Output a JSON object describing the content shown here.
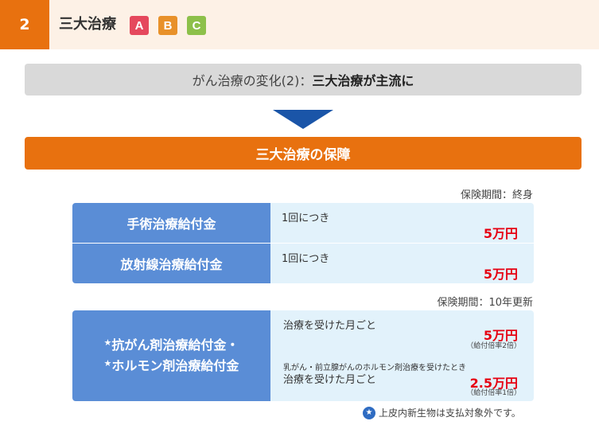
{
  "header": {
    "number": "2",
    "title": "三大治療",
    "badges": [
      {
        "label": "A",
        "color": "#e5485d"
      },
      {
        "label": "B",
        "color": "#e8912a"
      },
      {
        "label": "C",
        "color": "#8dc04a"
      }
    ]
  },
  "change_banner": {
    "prefix": "がん治療の変化(2)：",
    "emphasis": "三大治療が主流に"
  },
  "coverage_title": "三大治療の保障",
  "table1": {
    "period": "保険期間：終身",
    "rows": [
      {
        "label": "手術治療給付金",
        "condition": "1回につき",
        "amount": "5万円"
      },
      {
        "label": "放射線治療給付金",
        "condition": "1回につき",
        "amount": "5万円"
      }
    ]
  },
  "table2": {
    "period": "保険期間：10年更新",
    "star": "★",
    "label_line1": "抗がん剤治療給付金・",
    "label_line2": "ホルモン剤治療給付金",
    "condition1": "治療を受けた月ごと",
    "amount1": "5万円",
    "note1": "（給付倍率2倍）",
    "condition2_line1": "乳がん・前立腺がんのホルモン剤治療を受けたとき",
    "condition2_line2": "治療を受けた月ごと",
    "amount2": "2.5万円",
    "note2": "（給付倍率1倍）"
  },
  "footnote": {
    "icon": "star-icon",
    "text": "上皮内新生物は支払対象外です。"
  },
  "colors": {
    "accent_orange": "#e8710f",
    "label_blue": "#5a8dd6",
    "value_bg": "#e2f2fb",
    "amount_red": "#e60012",
    "arrow_blue": "#1a55a8"
  }
}
